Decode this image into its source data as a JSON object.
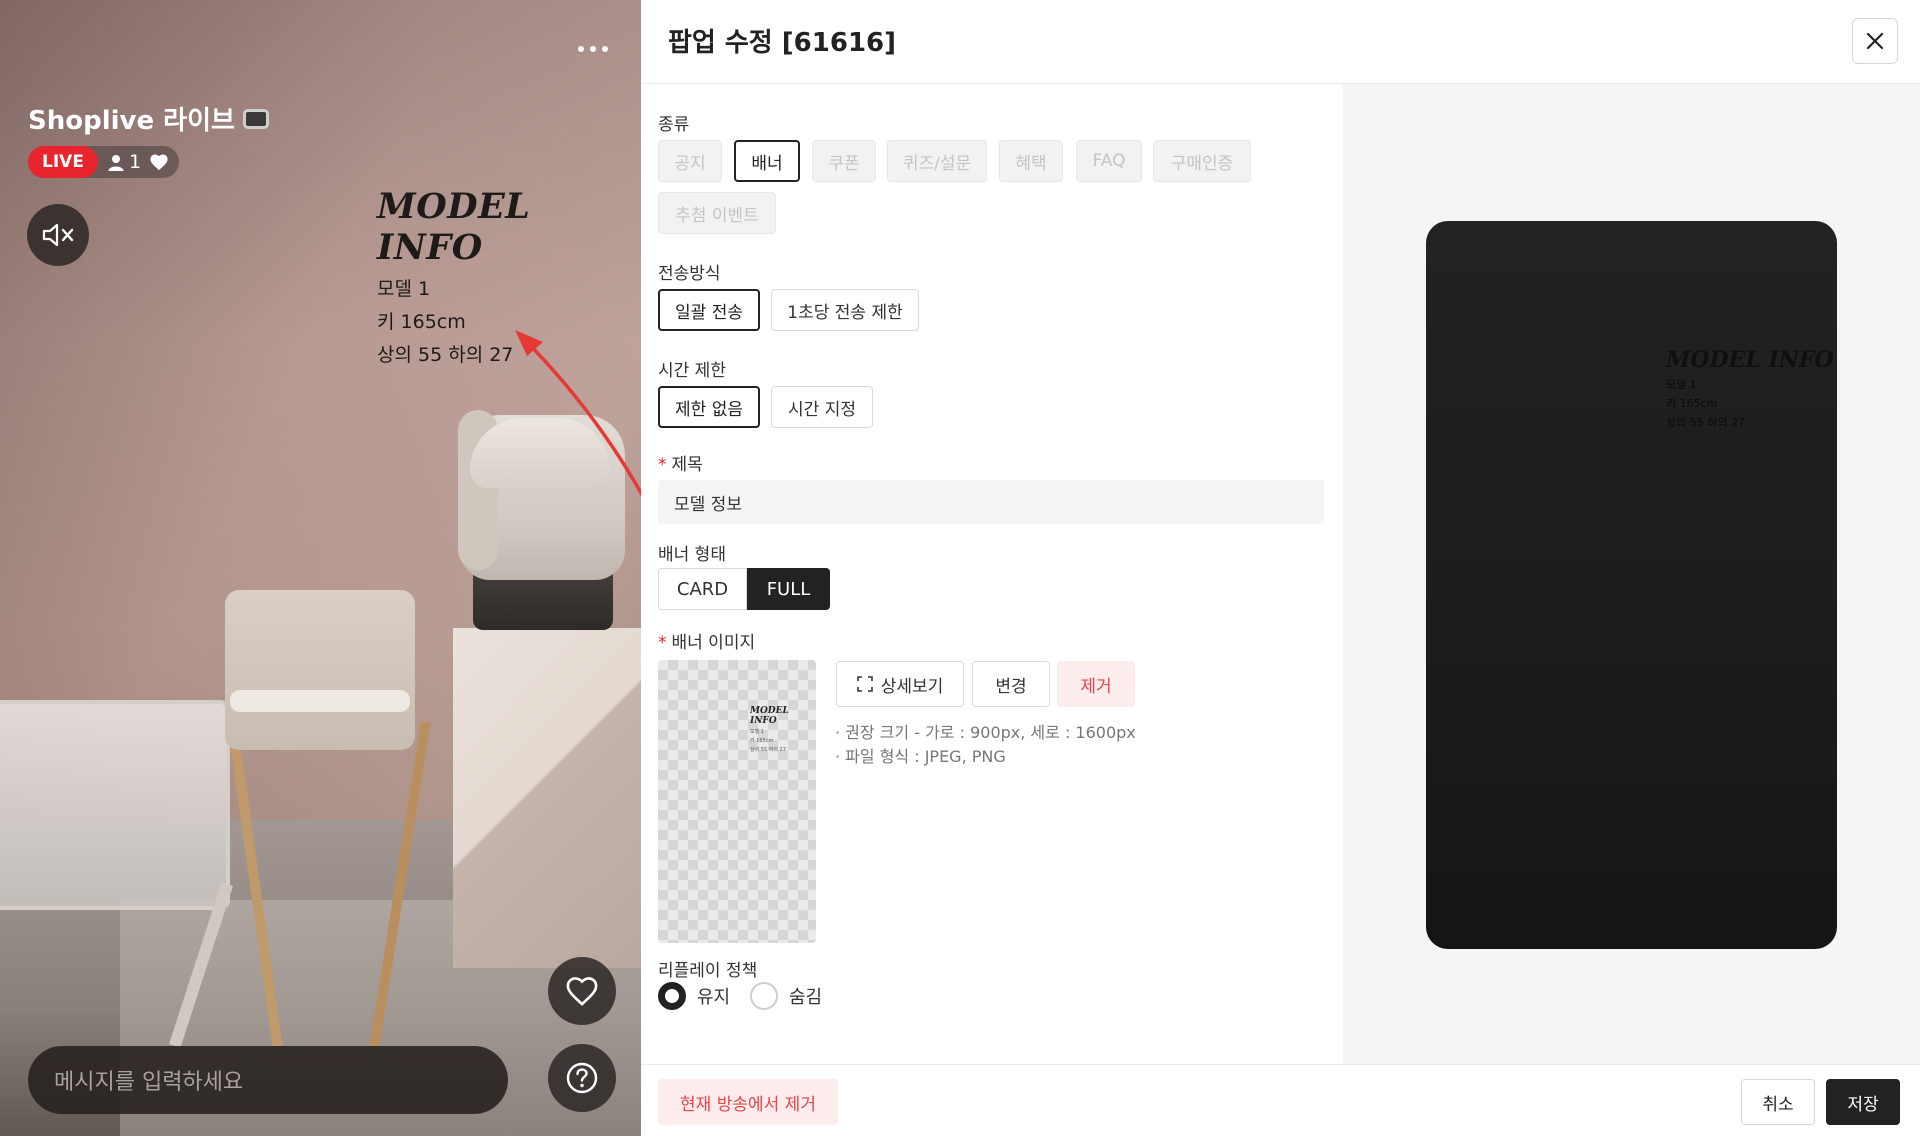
{
  "stream": {
    "title": "Shoplive 라이브",
    "title_emoji_icon": "tv-icon",
    "live_label": "LIVE",
    "viewer_count": "1",
    "chat_placeholder": "메시지를 입력하세요",
    "model_info": {
      "title": "MODEL INFO",
      "lines": [
        "모델 1",
        "키 165cm",
        "상의 55 하의 27"
      ]
    },
    "icons": {
      "more": "more-horizontal-icon",
      "mute": "speaker-mute-icon",
      "like": "heart-icon",
      "help": "question-icon"
    }
  },
  "modal": {
    "title": "팝업 수정 [61616]",
    "close_icon": "close-icon",
    "type": {
      "label": "종류",
      "options": [
        "공지",
        "배너",
        "쿠폰",
        "퀴즈/설문",
        "혜택",
        "FAQ",
        "구매인증",
        "추첨 이벤트"
      ],
      "selected": "배너"
    },
    "send_method": {
      "label": "전송방식",
      "options": [
        "일괄 전송",
        "1초당 전송 제한"
      ],
      "selected": "일괄 전송"
    },
    "time_limit": {
      "label": "시간 제한",
      "options": [
        "제한 없음",
        "시간 지정"
      ],
      "selected": "제한 없음"
    },
    "title_field": {
      "label": "제목",
      "value": "모델 정보"
    },
    "banner_type": {
      "label": "배너 형태",
      "options": [
        "CARD",
        "FULL"
      ],
      "selected": "FULL"
    },
    "banner_image": {
      "label": "배너 이미지",
      "detail_button": "상세보기",
      "change_button": "변경",
      "remove_button": "제거",
      "hint_size": "· 권장 크기 - 가로 : 900px, 세로 : 1600px",
      "hint_format": "· 파일 형식 : JPEG, PNG"
    },
    "replay_policy": {
      "label": "리플레이 정책",
      "options": [
        "유지",
        "숨김"
      ],
      "selected": "유지"
    },
    "footer": {
      "remove_from_broadcast": "현재 방송에서 제거",
      "cancel": "취소",
      "save": "저장"
    }
  },
  "colors": {
    "live_red": "#e8252c",
    "danger_text": "#e8454c",
    "danger_bg": "#fdecec",
    "dark": "#222222",
    "annotation_arrow": "#e53935"
  }
}
